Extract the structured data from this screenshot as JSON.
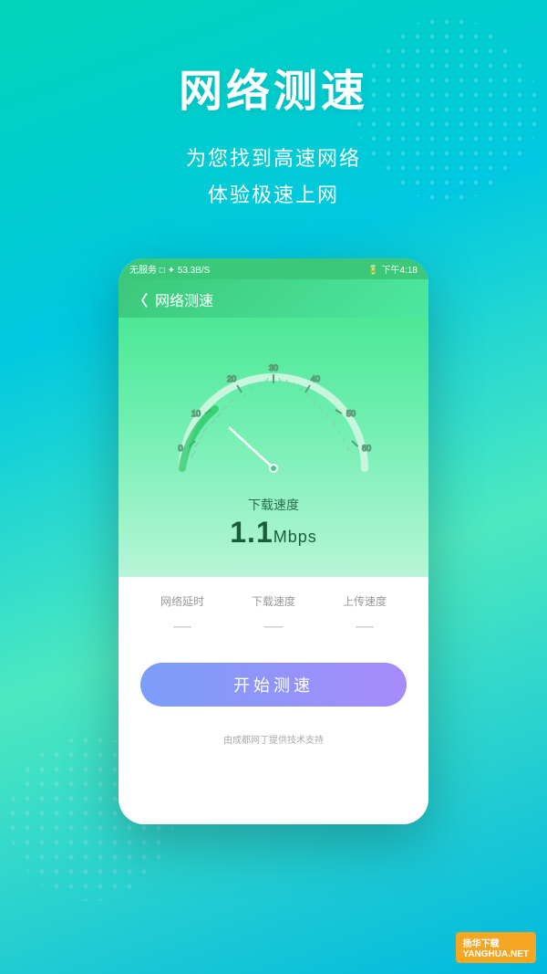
{
  "header": {
    "main_title": "网络测速",
    "subtitle_line1": "为您找到高速网络",
    "subtitle_line2": "体验极速上网"
  },
  "phone": {
    "status_bar": {
      "left_text": "无服务 □ ✦ 53.3B/S",
      "right_text": "🔋 下午4:18"
    },
    "nav": {
      "back_label": "〈",
      "title": "网络测速"
    },
    "speedometer": {
      "label": "下载速度",
      "value": "1.1",
      "unit": "Mbps"
    },
    "stats": [
      {
        "label": "网络延时",
        "value": "—"
      },
      {
        "label": "下载速度",
        "value": "—"
      },
      {
        "label": "上传速度",
        "value": "—"
      }
    ],
    "start_button": "开始测速",
    "footer_text": "由成都网丁提供技术支持"
  },
  "watermark": {
    "line1": "扬华下载",
    "line2": "YANGHUA.NET"
  },
  "colors": {
    "bg_gradient_start": "#00d4b8",
    "bg_gradient_end": "#00c8e0",
    "green_gradient_start": "#3cc87a",
    "button_gradient_start": "#7b9ef8",
    "button_gradient_end": "#a78bfa"
  }
}
